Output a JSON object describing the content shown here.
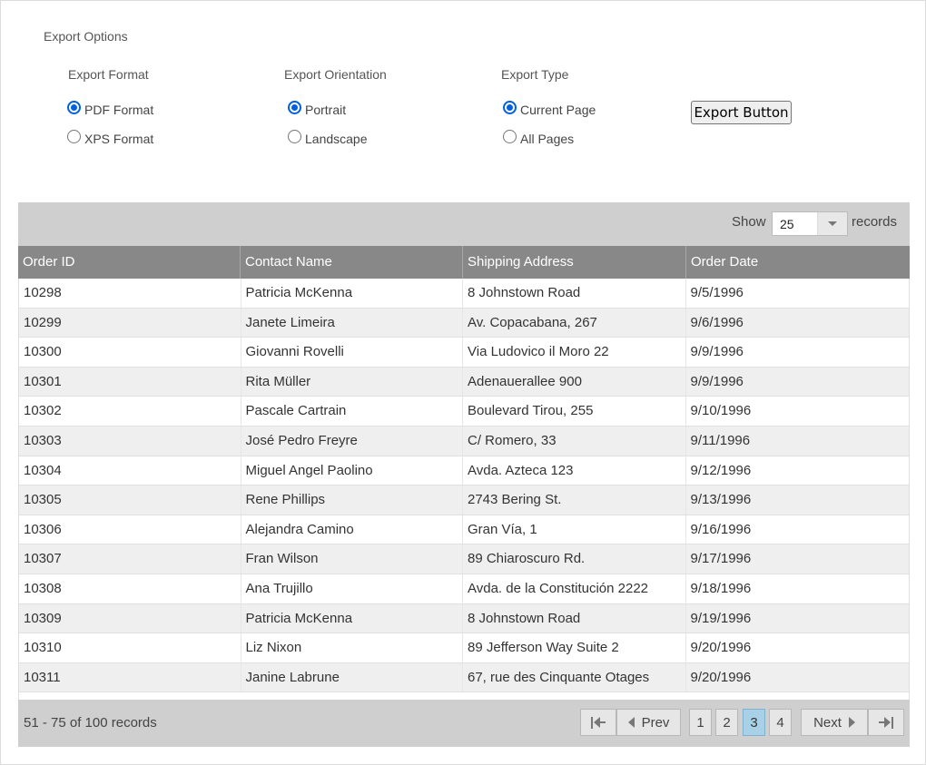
{
  "export_options": {
    "title": "Export Options",
    "groups": [
      {
        "title": "Export Format",
        "options": [
          {
            "label": "PDF Format",
            "checked": true
          },
          {
            "label": "XPS Format",
            "checked": false
          }
        ]
      },
      {
        "title": "Export Orientation",
        "options": [
          {
            "label": "Portrait",
            "checked": true
          },
          {
            "label": "Landscape",
            "checked": false
          }
        ]
      },
      {
        "title": "Export Type",
        "options": [
          {
            "label": "Current Page",
            "checked": true
          },
          {
            "label": "All Pages",
            "checked": false
          }
        ]
      }
    ],
    "button_label": "Export Button"
  },
  "toolbar": {
    "show_label": "Show",
    "page_size": "25",
    "records_label": "records"
  },
  "columns": [
    "Order ID",
    "Contact Name",
    "Shipping Address",
    "Order Date"
  ],
  "rows": [
    [
      "10298",
      "Patricia McKenna",
      "8 Johnstown Road",
      "9/5/1996"
    ],
    [
      "10299",
      "Janete Limeira",
      "Av. Copacabana, 267",
      "9/6/1996"
    ],
    [
      "10300",
      "Giovanni Rovelli",
      "Via Ludovico il Moro 22",
      "9/9/1996"
    ],
    [
      "10301",
      "Rita Müller",
      "Adenauerallee 900",
      "9/9/1996"
    ],
    [
      "10302",
      "Pascale Cartrain",
      "Boulevard Tirou, 255",
      "9/10/1996"
    ],
    [
      "10303",
      "José Pedro Freyre",
      "C/ Romero, 33",
      "9/11/1996"
    ],
    [
      "10304",
      "Miguel Angel Paolino",
      "Avda. Azteca 123",
      "9/12/1996"
    ],
    [
      "10305",
      "Rene Phillips",
      "2743 Bering St.",
      "9/13/1996"
    ],
    [
      "10306",
      "Alejandra Camino",
      "Gran Vía, 1",
      "9/16/1996"
    ],
    [
      "10307",
      "Fran Wilson",
      "89 Chiaroscuro Rd.",
      "9/17/1996"
    ],
    [
      "10308",
      "Ana Trujillo",
      "Avda. de la Constitución 2222",
      "9/18/1996"
    ],
    [
      "10309",
      "Patricia McKenna",
      "8 Johnstown Road",
      "9/19/1996"
    ],
    [
      "10310",
      "Liz Nixon",
      "89 Jefferson Way Suite 2",
      "9/20/1996"
    ],
    [
      "10311",
      "Janine Labrune",
      "67, rue des Cinquante Otages",
      "9/20/1996"
    ]
  ],
  "pager": {
    "summary": "51 - 75 of 100 records",
    "prev_label": "Prev",
    "next_label": "Next",
    "pages": [
      "1",
      "2",
      "3",
      "4"
    ],
    "current_page": "3"
  },
  "colors": {
    "header_bg": "#888888",
    "toolbar_bg": "#cfcfcf",
    "active_page": "#a8d0e6",
    "radio_accent": "#0060df"
  }
}
